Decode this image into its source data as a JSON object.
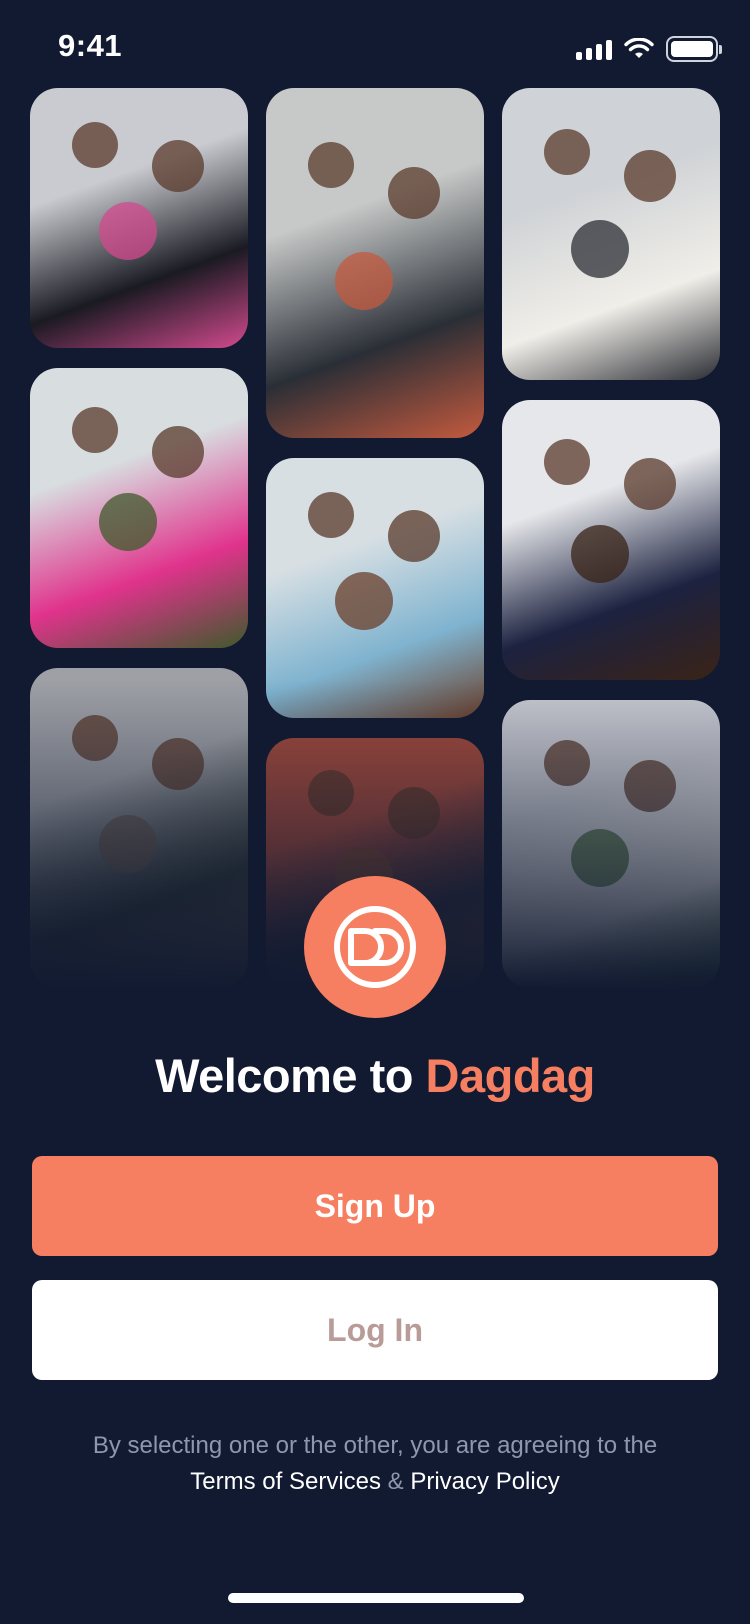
{
  "status_bar": {
    "time": "9:41",
    "icons": [
      "cellular-signal-icon",
      "wifi-icon",
      "battery-icon"
    ]
  },
  "photo_grid": {
    "photos": [
      {
        "name": "photo-women-event-lanyards",
        "colors": [
          "#c9cbd0",
          "#1a1a22",
          "#d24a8e"
        ]
      },
      {
        "name": "photo-group-on-stairs",
        "colors": [
          "#c7c9c8",
          "#2a2e36",
          "#c45a3e"
        ]
      },
      {
        "name": "photo-couple-hugging",
        "colors": [
          "#cfd2d6",
          "#f0eee8",
          "#2b2d34"
        ]
      },
      {
        "name": "photo-women-in-pink",
        "colors": [
          "#d8dde0",
          "#e0338c",
          "#3f5a2b"
        ]
      },
      {
        "name": "photo-kids-group",
        "colors": [
          "#d7dfe3",
          "#7fb3cf",
          "#6b3f2a"
        ]
      },
      {
        "name": "photo-woman-curly-hair",
        "colors": [
          "#e6e7ea",
          "#1c2240",
          "#3a2317"
        ]
      },
      {
        "name": "photo-woman-confetti",
        "colors": [
          "#9ea0a6",
          "#2f3835",
          "#6a5a50"
        ]
      },
      {
        "name": "photo-woman-smiling-red-wall",
        "colors": [
          "#a44a3c",
          "#2d2a3a",
          "#7a4a33"
        ]
      },
      {
        "name": "photo-group-lying-on-blanket",
        "colors": [
          "#c9cbd2",
          "#e8e7e3",
          "#4a6e3a"
        ]
      }
    ]
  },
  "logo": {
    "text": "DD",
    "color": "#f77f61"
  },
  "welcome": {
    "prefix": "Welcome to ",
    "brand": "Dagdag"
  },
  "buttons": {
    "signup": "Sign Up",
    "login": "Log In"
  },
  "legal": {
    "text": "By selecting one or the other, you are agreeing to the",
    "terms": "Terms of Services",
    "separator": " & ",
    "privacy": "Privacy Policy"
  },
  "colors": {
    "background": "#111a31",
    "accent": "#f77f61",
    "muted_text": "#8e97ab"
  }
}
